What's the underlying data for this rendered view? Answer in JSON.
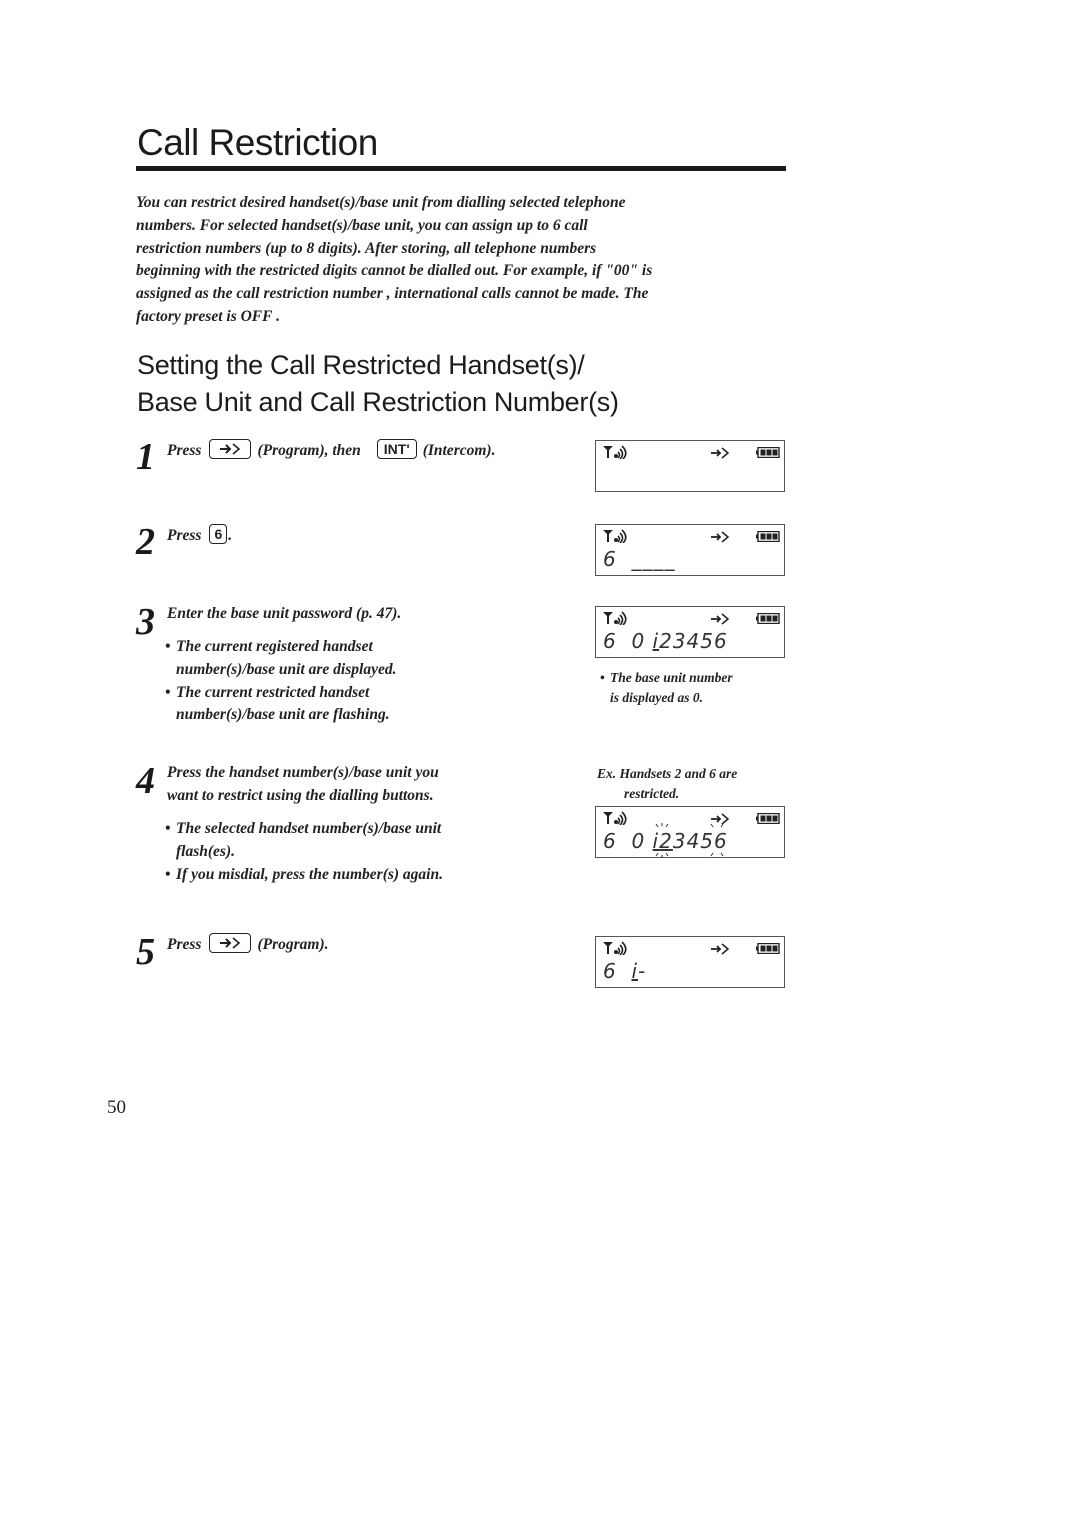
{
  "page": {
    "title": "Call Restriction",
    "intro_lines": [
      "You can restrict desired handset(s)/base unit from dialling selected telephone",
      "numbers. For selected handset(s)/base unit, you can assign up to 6 call",
      "restriction numbers (up to 8 digits).    After storing, all telephone numbers",
      "beginning with the restricted digits cannot be dialled out. For example, if \"00\" is",
      "assigned as the call restriction number    , international calls cannot be made.     The",
      "factory preset is OFF  ."
    ],
    "subtitle_lines": [
      "Setting the Call Restricted Handset(s)/",
      "Base Unit and Call Restriction Number(s)"
    ],
    "page_number": "50"
  },
  "icons": {
    "program_key": "program-arrow-icon",
    "signal": "antenna-signal-icon",
    "battery": "battery-full-icon"
  },
  "steps": [
    {
      "number": "1",
      "press": "Press",
      "after_key1": "(Program), then",
      "key2_label": "INT'",
      "after_key2": "(Intercom).",
      "display_line2": ""
    },
    {
      "number": "2",
      "press": "Press",
      "key_label": "6",
      "after_key": ".",
      "display_line2": "6  ____"
    },
    {
      "number": "3",
      "text": "Enter the base unit password (p. 47).",
      "bullets": [
        [
          "The current registered handset",
          "number(s)/base unit are displayed."
        ],
        [
          "The current restricted handset",
          "number(s)/base unit are flashing."
        ]
      ],
      "display_prefix": "6  0 ",
      "display_underlined": "i",
      "display_rest": "23456",
      "display_note": [
        "The base unit number",
        "is displayed as 0."
      ]
    },
    {
      "number": "4",
      "text_lines": [
        "Press the handset number(s)/base unit you",
        "want to restrict using the dialling buttons."
      ],
      "bullets": [
        [
          "The selected handset number(s)/base unit",
          "flash(es)."
        ],
        [
          "If you misdial, press the number(s) again."
        ]
      ],
      "example_lines": [
        "Ex. Handsets 2 and 6 are",
        "restricted."
      ],
      "display_prefix": "6  0 ",
      "display_underlined": "i",
      "display_digits": [
        "2",
        "3",
        "4",
        "5",
        "6"
      ],
      "flashing_digits": [
        "2",
        "6"
      ]
    },
    {
      "number": "5",
      "press": "Press",
      "after_key": "(Program).",
      "display_prefix": "6  ",
      "display_underlined": "i",
      "display_rest": "-"
    }
  ],
  "bullet_char": "•"
}
